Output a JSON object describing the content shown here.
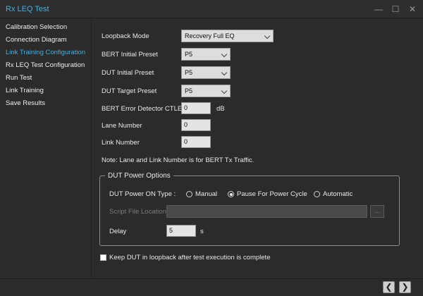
{
  "window": {
    "title": "Rx LEQ Test",
    "minimize_glyph": "—",
    "maximize_glyph": "☐",
    "close_glyph": "✕"
  },
  "sidebar": {
    "items": [
      {
        "label": "Calibration Selection"
      },
      {
        "label": "Connection Diagram"
      },
      {
        "label": "Link Training Configuration",
        "active": true
      },
      {
        "label": "Rx LEQ Test Configuration"
      },
      {
        "label": "Run Test"
      },
      {
        "label": "Link Training"
      },
      {
        "label": "Save Results"
      }
    ]
  },
  "form": {
    "loopback_mode": {
      "label": "Loopback Mode",
      "value": "Recovery Full EQ"
    },
    "bert_initial_preset": {
      "label": "BERT Initial Preset",
      "value": "P5"
    },
    "dut_initial_preset": {
      "label": "DUT Initial Preset",
      "value": "P5"
    },
    "dut_target_preset": {
      "label": "DUT Target Preset",
      "value": "P5"
    },
    "bert_error_ctle": {
      "label": "BERT Error Detector CTLE",
      "value": "0",
      "unit": "dB"
    },
    "lane_number": {
      "label": "Lane Number",
      "value": "0"
    },
    "link_number": {
      "label": "Link Number",
      "value": "0"
    },
    "note": "Note: Lane and Link Number is for BERT Tx Traffic."
  },
  "power_options": {
    "group_title": "DUT Power Options",
    "power_on_type_label": "DUT Power ON Type :",
    "radio_manual": "Manual",
    "radio_pause": "Pause For Power Cycle",
    "radio_automatic": "Automatic",
    "selected": "Pause For Power Cycle",
    "script_label": "Script File Location",
    "script_value": "",
    "browse_label": "...",
    "delay_label": "Delay",
    "delay_value": "5",
    "delay_unit": "s"
  },
  "keep_loopback": {
    "label": "Keep DUT in loopback after test execution is complete",
    "checked": false
  },
  "nav": {
    "back_glyph": "❮",
    "next_glyph": "❯"
  },
  "colors": {
    "accent": "#3fb2e5",
    "background": "#2b2b2b"
  }
}
